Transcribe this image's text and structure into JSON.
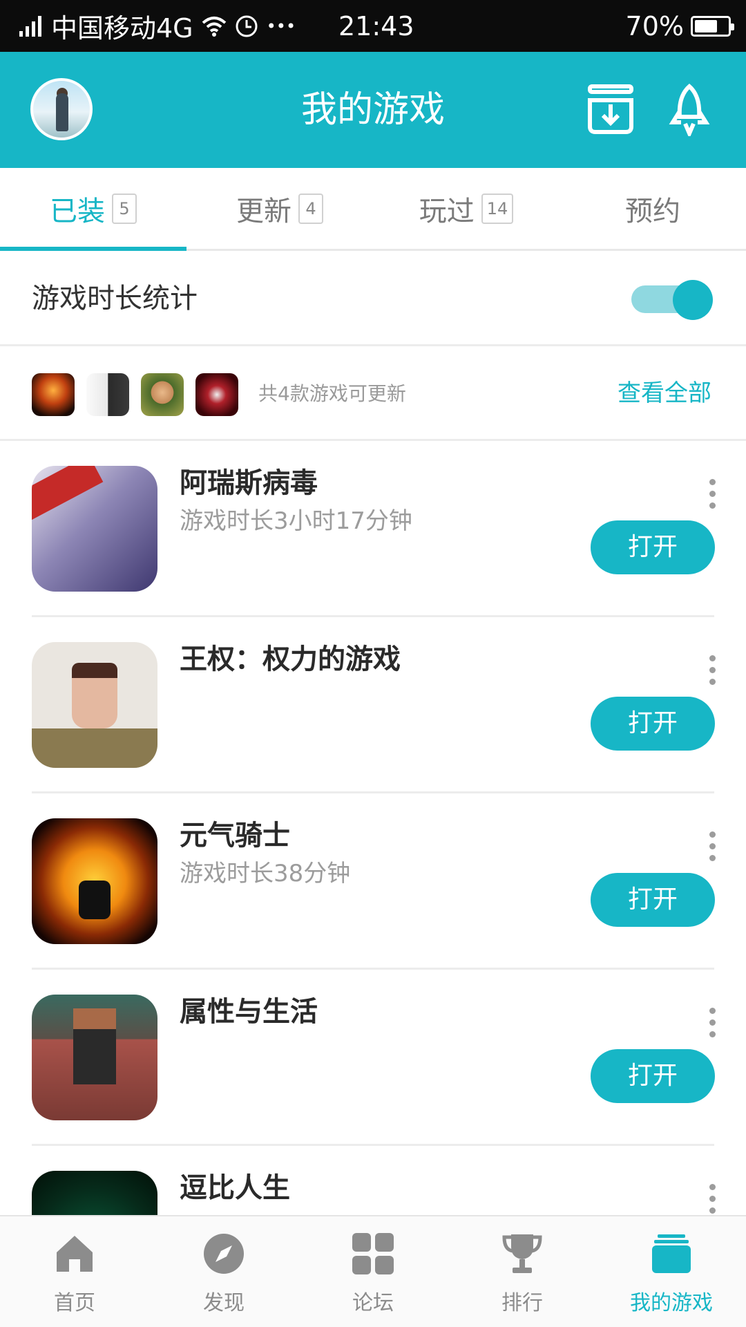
{
  "statusbar": {
    "carrier": "中国移动4G",
    "time": "21:43",
    "battery": "70%",
    "battery_level": 0.7,
    "more": "•••"
  },
  "header": {
    "title": "我的游戏",
    "avatar_icon": "avatar",
    "download_icon": "download-icon",
    "rocket_icon": "rocket-icon"
  },
  "tabs": [
    {
      "label": "已装",
      "badge": "5",
      "active": true
    },
    {
      "label": "更新",
      "badge": "4",
      "active": false
    },
    {
      "label": "玩过",
      "badge": "14",
      "active": false
    },
    {
      "label": "预约",
      "badge": "",
      "active": false
    }
  ],
  "stats": {
    "label": "游戏时长统计",
    "toggle_on": true
  },
  "updates": {
    "text": "共4款游戏可更新",
    "link": "查看全部"
  },
  "games": [
    {
      "name": "阿瑞斯病毒",
      "time": "游戏时长3小时17分钟",
      "button": "打开"
    },
    {
      "name": "王权：权力的游戏",
      "time": "",
      "button": "打开"
    },
    {
      "name": "元气骑士",
      "time": "游戏时长38分钟",
      "button": "打开"
    },
    {
      "name": "属性与生活",
      "time": "",
      "button": "打开"
    },
    {
      "name": "逗比人生",
      "time": "",
      "button": ""
    }
  ],
  "bottom_nav": [
    {
      "label": "首页",
      "icon": "home-icon"
    },
    {
      "label": "发现",
      "icon": "compass-icon"
    },
    {
      "label": "论坛",
      "icon": "grid-icon"
    },
    {
      "label": "排行",
      "icon": "trophy-icon"
    },
    {
      "label": "我的游戏",
      "icon": "games-icon",
      "active": true
    }
  ],
  "colors": {
    "accent": "#17b6c6",
    "statusbar": "#0c0c0c"
  }
}
